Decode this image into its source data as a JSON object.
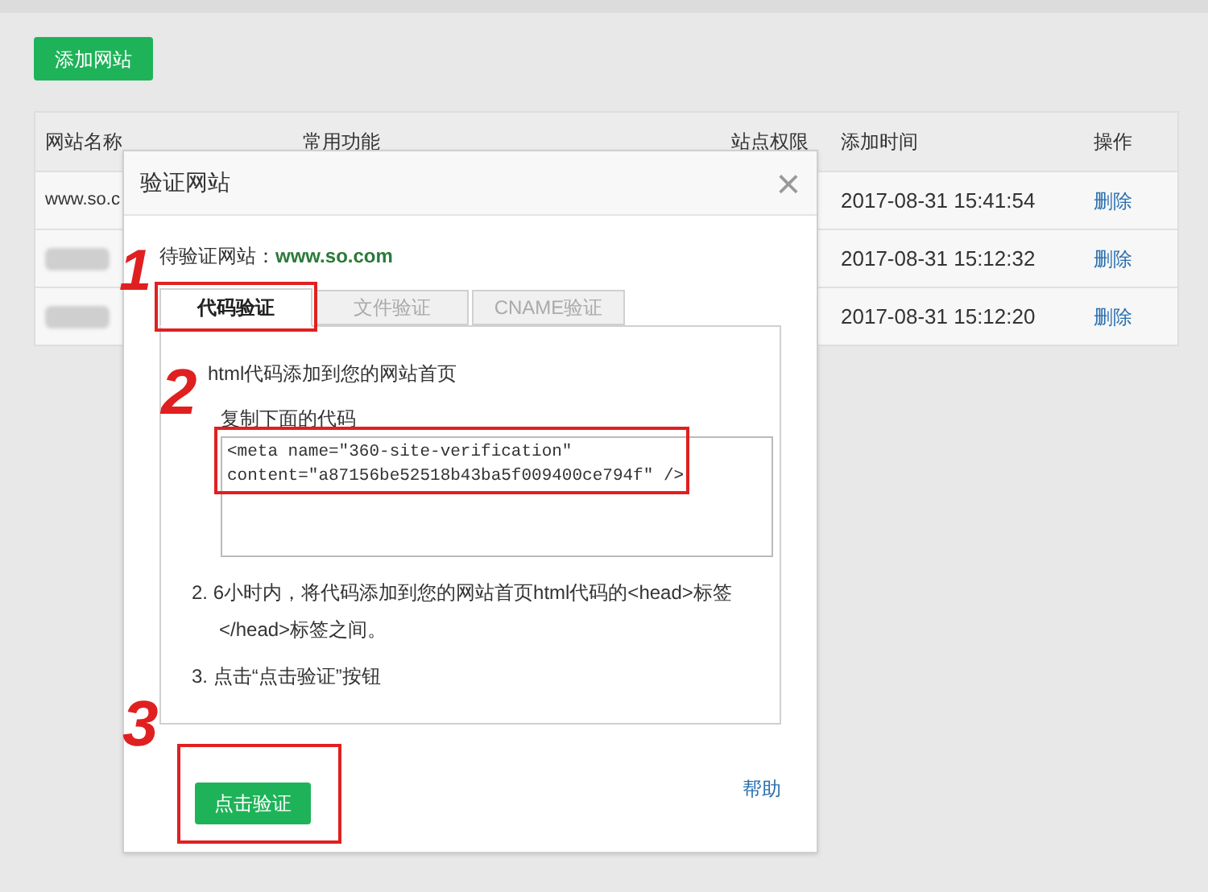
{
  "add_button": "添加网站",
  "table": {
    "columns": [
      "网站名称",
      "常用功能",
      "站点权限",
      "添加时间",
      "操作"
    ],
    "rows": [
      {
        "name": "www.so.c",
        "blurred": false,
        "time": "2017-08-31 15:41:54",
        "action": "删除"
      },
      {
        "blurred": true,
        "time": "2017-08-31 15:12:32",
        "action": "删除"
      },
      {
        "blurred": true,
        "time": "2017-08-31 15:12:20",
        "action": "删除"
      }
    ]
  },
  "dialog": {
    "title": "验证网站",
    "close": "×",
    "site_label": "待验证网站：",
    "site": "www.so.com",
    "tabs": [
      {
        "label": "代码验证",
        "selected": true
      },
      {
        "label": "文件验证",
        "selected": false
      },
      {
        "label": "CNAME验证",
        "selected": false
      }
    ],
    "intro": "html代码添加到您的网站首页",
    "step_1": "复制下面的代码",
    "code": "<meta name=\"360-site-verification\"\ncontent=\"a87156be52518b43ba5f009400ce794f\" />",
    "step_2": "2. 6小时内，将代码添加到您的网站首页html代码的<head>标签</head>标签之间。",
    "step_3": "3. 点击“点击验证”按钮",
    "verify_button": "点击验证",
    "help": "帮助"
  },
  "annotations": [
    "1",
    "2",
    "3"
  ]
}
